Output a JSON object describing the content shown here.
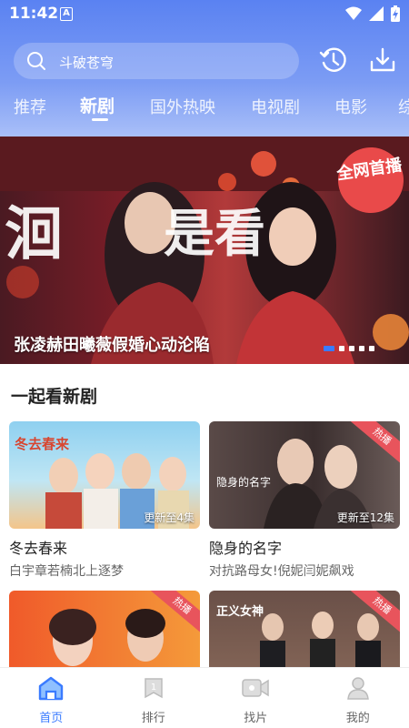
{
  "status_bar": {
    "time": "11:42",
    "notif_letter": "A"
  },
  "search": {
    "placeholder": "斗破苍穹"
  },
  "tabs": [
    {
      "label": "推荐"
    },
    {
      "label": "新剧"
    },
    {
      "label": "国外热映"
    },
    {
      "label": "电视剧"
    },
    {
      "label": "电影"
    },
    {
      "label": "综"
    }
  ],
  "banner": {
    "title": "张凌赫田曦薇假婚心动沦陷",
    "big_text_left": "洄",
    "big_text_right": "是看",
    "badge": "全网首播",
    "page_count": 5,
    "active_index": 0
  },
  "section": {
    "title": "一起看新剧"
  },
  "cards": [
    {
      "title": "冬去春来",
      "subtitle": "白宇章若楠北上逐梦",
      "episode": "更新至4集",
      "badge": "",
      "thumb_text": "冬去春来"
    },
    {
      "title": "隐身的名字",
      "subtitle": "对抗路母女!倪妮闫妮飙戏",
      "episode": "更新至12集",
      "badge": "热播",
      "thumb_text": "隐身的名字"
    },
    {
      "title": "",
      "subtitle": "",
      "episode": "",
      "badge": "热播",
      "thumb_text": ""
    },
    {
      "title": "",
      "subtitle": "",
      "episode": "",
      "badge": "热播",
      "thumb_text": "正义女神"
    }
  ],
  "bottom_nav": [
    {
      "label": "首页",
      "icon": "home-icon",
      "active": true
    },
    {
      "label": "排行",
      "icon": "ranking-icon",
      "active": false
    },
    {
      "label": "找片",
      "icon": "video-icon",
      "active": false
    },
    {
      "label": "我的",
      "icon": "profile-icon",
      "active": false
    }
  ],
  "colors": {
    "accent": "#3a7bff",
    "header_top": "#5a82f2",
    "badge": "#e8545c"
  }
}
